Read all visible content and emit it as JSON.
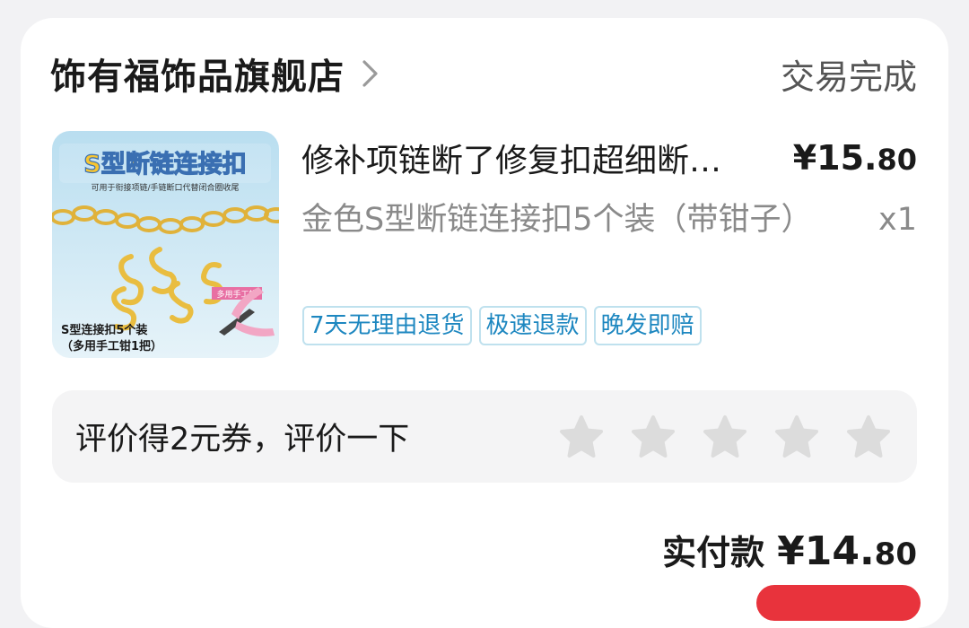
{
  "shop": {
    "name": "饰有福饰品旗舰店",
    "status": "交易完成"
  },
  "item": {
    "title": "修补项链断了修复扣超细断…",
    "price_symbol": "¥",
    "price_int": "15.",
    "price_dec": "80",
    "spec": "金色S型断链连接扣5个装（带钳子）",
    "qty": "x1",
    "thumb": {
      "headline": "S型断链连接扣",
      "subline": "可用于衔接项链/手链断口代替闭合圈收尾",
      "caption1": "S型连接扣5个装",
      "caption2": "（多用手工钳1把）",
      "pliers_label": "多用手工钳"
    }
  },
  "tags": [
    "7天无理由退货",
    "极速退款",
    "晚发即赔"
  ],
  "review": {
    "text": "评价得2元券，评价一下",
    "stars": 5,
    "star_color": "#dcdcdc"
  },
  "payment": {
    "label": "实付款",
    "symbol": "¥",
    "int": "14.",
    "dec": "80"
  }
}
